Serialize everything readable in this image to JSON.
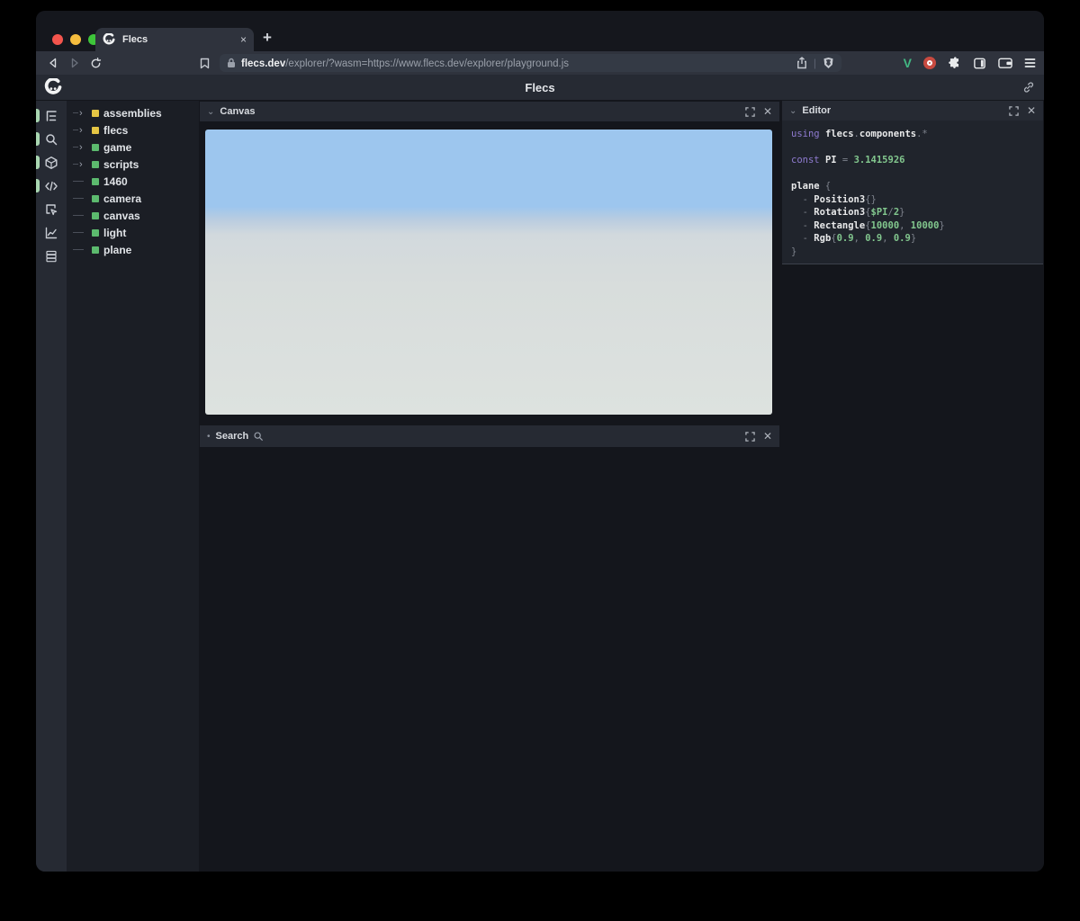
{
  "browser": {
    "tab": {
      "title": "Flecs",
      "close_label": "×",
      "new_tab_label": "+"
    },
    "url": {
      "domain": "flecs.dev",
      "path": "/explorer/?wasm=https://www.flecs.dev/explorer/playground.js"
    },
    "toolbar_icons": [
      "back-icon",
      "forward-icon",
      "reload-icon",
      "bookmark-icon",
      "lock-icon",
      "share-icon",
      "brave-shield-icon",
      "vue-extension-icon",
      "red-extension-icon",
      "puzzle-extension-icon",
      "sidebar-toggle-icon",
      "wallet-icon",
      "menu-icon"
    ],
    "vue_letter": "V"
  },
  "header": {
    "title": "Flecs",
    "icons": [
      "flecs-logo",
      "link-icon"
    ]
  },
  "sidebar": {
    "active_color": "#a9d7b1",
    "items": [
      {
        "icon": "entity-tree-icon",
        "active": true
      },
      {
        "icon": "search-icon",
        "active": true
      },
      {
        "icon": "cube-icon",
        "active": true
      },
      {
        "icon": "code-icon",
        "active": true
      },
      {
        "icon": "inspect-icon",
        "active": false
      },
      {
        "icon": "chart-icon",
        "active": false
      },
      {
        "icon": "stack-icon",
        "active": false
      }
    ]
  },
  "tree": {
    "items": [
      {
        "label": "assemblies",
        "color": "yellow",
        "expandable": true
      },
      {
        "label": "flecs",
        "color": "yellow",
        "expandable": true
      },
      {
        "label": "game",
        "color": "green",
        "expandable": true
      },
      {
        "label": "scripts",
        "color": "green",
        "expandable": true
      },
      {
        "label": "1460",
        "color": "green",
        "expandable": false
      },
      {
        "label": "camera",
        "color": "green",
        "expandable": false
      },
      {
        "label": "canvas",
        "color": "green",
        "expandable": false
      },
      {
        "label": "light",
        "color": "green",
        "expandable": false
      },
      {
        "label": "plane",
        "color": "green",
        "expandable": false
      }
    ]
  },
  "panels": {
    "canvas": {
      "title": "Canvas",
      "collapse_chevron": "⌄",
      "close_label": "✕"
    },
    "search": {
      "title": "Search",
      "collapse_dot": "•",
      "close_label": "✕"
    },
    "editor": {
      "title": "Editor",
      "collapse_chevron": "⌄",
      "close_label": "✕"
    }
  },
  "editor_code": {
    "lines": [
      [
        {
          "t": "using ",
          "c": "k"
        },
        {
          "t": "flecs",
          "c": "i"
        },
        {
          "t": ".",
          "c": "p"
        },
        {
          "t": "components",
          "c": "i"
        },
        {
          "t": ".*",
          "c": "p"
        }
      ],
      [],
      [
        {
          "t": "const ",
          "c": "k"
        },
        {
          "t": "PI",
          "c": "i"
        },
        {
          "t": " = ",
          "c": "p"
        },
        {
          "t": "3.1415926",
          "c": "n"
        }
      ],
      [],
      [
        {
          "t": "plane",
          "c": "i"
        },
        {
          "t": " {",
          "c": "p"
        }
      ],
      [
        {
          "t": "  - ",
          "c": "p"
        },
        {
          "t": "Position3",
          "c": "i"
        },
        {
          "t": "{}",
          "c": "p"
        }
      ],
      [
        {
          "t": "  - ",
          "c": "p"
        },
        {
          "t": "Rotation3",
          "c": "i"
        },
        {
          "t": "{",
          "c": "p"
        },
        {
          "t": "$PI",
          "c": "v"
        },
        {
          "t": "/",
          "c": "p"
        },
        {
          "t": "2",
          "c": "n"
        },
        {
          "t": "}",
          "c": "p"
        }
      ],
      [
        {
          "t": "  - ",
          "c": "p"
        },
        {
          "t": "Rectangle",
          "c": "i"
        },
        {
          "t": "{",
          "c": "p"
        },
        {
          "t": "10000",
          "c": "n"
        },
        {
          "t": ", ",
          "c": "p"
        },
        {
          "t": "10000",
          "c": "n"
        },
        {
          "t": "}",
          "c": "p"
        }
      ],
      [
        {
          "t": "  - ",
          "c": "p"
        },
        {
          "t": "Rgb",
          "c": "i"
        },
        {
          "t": "{",
          "c": "p"
        },
        {
          "t": "0.9",
          "c": "n"
        },
        {
          "t": ", ",
          "c": "p"
        },
        {
          "t": "0.9",
          "c": "n"
        },
        {
          "t": ", ",
          "c": "p"
        },
        {
          "t": "0.9",
          "c": "n"
        },
        {
          "t": "}",
          "c": "p"
        }
      ],
      [
        {
          "t": "}",
          "c": "p"
        }
      ]
    ]
  },
  "colors": {
    "yellow": "#e5c544",
    "green": "#5cba6e",
    "active_pill": "#a9d7b1",
    "sky": "#9dc6ee",
    "ground": "#dde2df",
    "syntax_keyword": "#8f7bd0",
    "syntax_identifier": "#e8e9ea",
    "syntax_number": "#82c78e",
    "syntax_punct": "#7d828c"
  }
}
